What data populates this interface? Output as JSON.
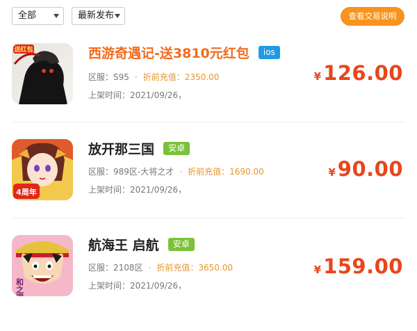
{
  "filters": {
    "category": "全部",
    "sort": "最新发布",
    "explain_button": "查看交易说明"
  },
  "listings": [
    {
      "title": "西游奇遇记-送3810元红包",
      "tag": "ios",
      "server": "区服：S95",
      "recharge": "折前充值：2350.00",
      "listed": "上架时间：2021/09/26，",
      "currency": "¥",
      "price": "126.00",
      "thumb_text": "送红包"
    },
    {
      "title": "放开那三国",
      "tag": "安卓",
      "server": "区服：989区-大将之才",
      "recharge": "折前充值：1690.00",
      "listed": "上架时间：2021/09/26，",
      "currency": "¥",
      "price": "90.00",
      "thumb_text": "4周年"
    },
    {
      "title": "航海王 启航",
      "tag": "安卓",
      "server": "区服：2108区",
      "recharge": "折前充值：3650.00",
      "listed": "上架时间：2021/09/26，",
      "currency": "¥",
      "price": "159.00",
      "thumb_text": "和之国篇"
    }
  ],
  "colors": {
    "accent_orange": "#f7931e",
    "price_red": "#e8461c",
    "title_orange": "#f26b1d",
    "ios_blue": "#1e9be5",
    "android_green": "#7cc13a"
  }
}
